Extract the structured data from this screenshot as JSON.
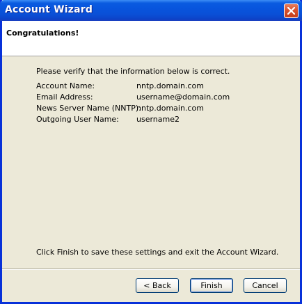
{
  "window": {
    "title": "Account Wizard",
    "close_icon": "close-icon"
  },
  "header": {
    "title": "Congratulations!"
  },
  "body": {
    "intro": "Please verify that the information below is correct.",
    "rows": [
      {
        "label": "Account Name:",
        "value": "nntp.domain.com"
      },
      {
        "label": "Email Address:",
        "value": "username@domain.com"
      },
      {
        "label": "News Server Name (NNTP):",
        "value": "nntp.domain.com"
      },
      {
        "label": "Outgoing User Name:",
        "value": "username2"
      }
    ],
    "finish_note": "Click Finish to save these settings and exit the Account Wizard."
  },
  "buttons": {
    "back": "< Back",
    "finish": "Finish",
    "cancel": "Cancel"
  },
  "colors": {
    "titlebar": "#0a5be0",
    "window_bg": "#ece9d8",
    "close_button": "#d8512e"
  }
}
